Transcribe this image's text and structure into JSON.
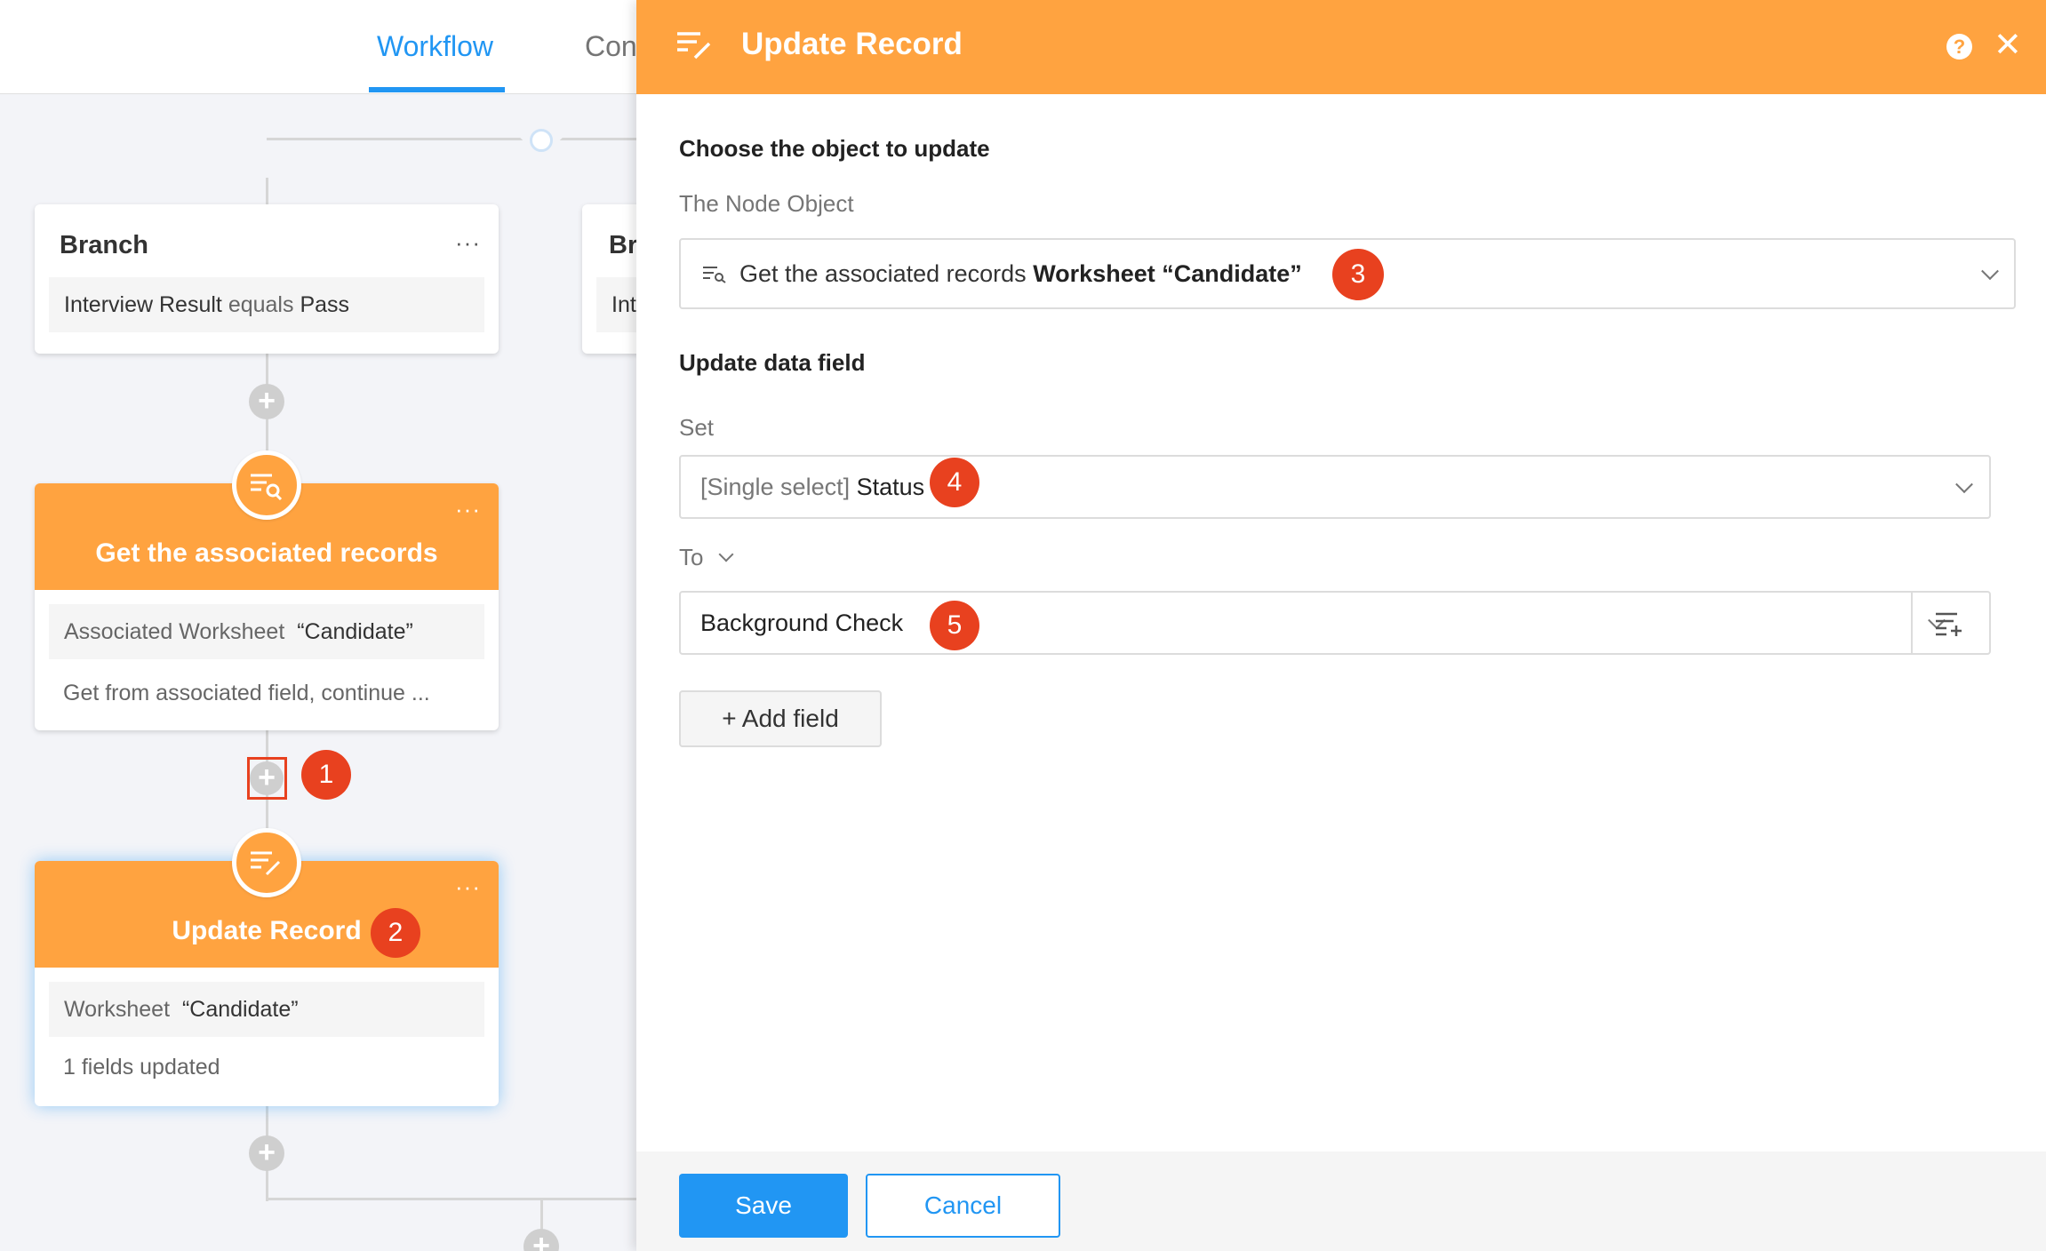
{
  "tabs": {
    "workflow": "Workflow",
    "con": "Con"
  },
  "canvas": {
    "branch1": {
      "title": "Branch",
      "field": "Interview Result",
      "op": "equals",
      "value": "Pass"
    },
    "branch2": {
      "title_partial": "Br",
      "row_partial": "Int"
    },
    "get_node": {
      "title": "Get the associated records",
      "row1_label": "Associated Worksheet",
      "row1_value": "“Candidate”",
      "row2": "Get from associated field, continue ..."
    },
    "update_node": {
      "title": "Update Record",
      "row1_label": "Worksheet",
      "row1_value": "“Candidate”",
      "row2": "1 fields updated"
    },
    "menu_dots": "···",
    "add_symbol": "+"
  },
  "badges": {
    "b1": "1",
    "b2": "2",
    "b3": "3",
    "b4": "4",
    "b5": "5"
  },
  "panel": {
    "title": "Update Record",
    "help": "?",
    "close": "✕",
    "choose_title": "Choose the object to update",
    "node_object_label": "The Node Object",
    "node_object_prefix": "Get the associated records",
    "node_object_bold": "Worksheet “Candidate”",
    "update_title": "Update data field",
    "set_label": "Set",
    "set_type": "[Single select]",
    "set_field": "Status",
    "to_label": "To",
    "to_value": "Background Check",
    "add_field": "+ Add field",
    "save": "Save",
    "cancel": "Cancel"
  },
  "colors": {
    "accent_orange": "#ffa340",
    "accent_blue": "#2196f3",
    "badge_red": "#e8411f"
  }
}
